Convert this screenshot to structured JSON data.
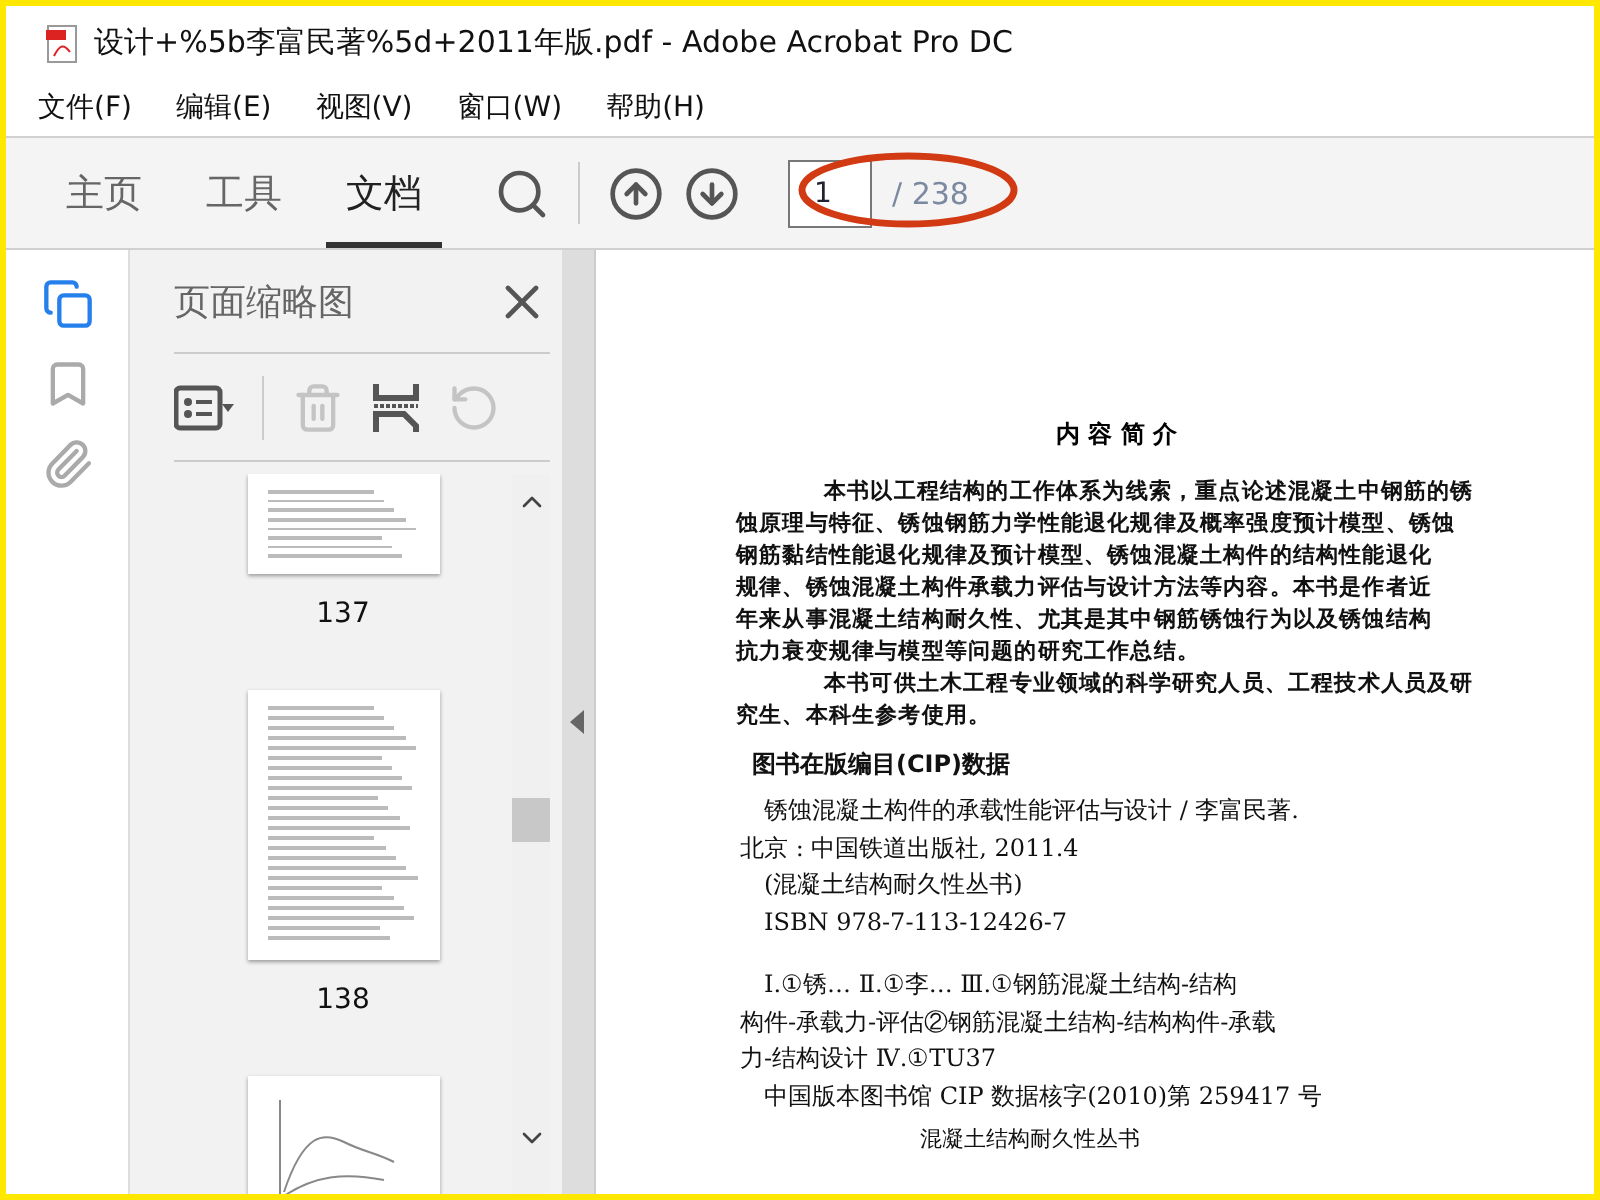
{
  "window": {
    "title": "设计+%5b李富民著%5d+2011年版.pdf - Adobe Acrobat Pro DC"
  },
  "menu": [
    {
      "label": "文件(F)"
    },
    {
      "label": "编辑(E)"
    },
    {
      "label": "视图(V)"
    },
    {
      "label": "窗口(W)"
    },
    {
      "label": "帮助(H)"
    }
  ],
  "tabs": [
    {
      "label": "主页",
      "selected": false
    },
    {
      "label": "工具",
      "selected": false
    },
    {
      "label": "文档",
      "selected": true
    }
  ],
  "page_nav": {
    "current": "1",
    "total": "/ 238"
  },
  "side_rail": [
    {
      "kind": "pages",
      "selected": true
    },
    {
      "kind": "bookmarks",
      "selected": false
    },
    {
      "kind": "attachments",
      "selected": false
    }
  ],
  "thumbnail_panel": {
    "title": "页面缩略图",
    "tools": [
      {
        "kind": "options",
        "disabled": false
      },
      {
        "kind": "delete",
        "disabled": true
      },
      {
        "kind": "insert",
        "disabled": false
      },
      {
        "kind": "rotate",
        "disabled": true
      }
    ],
    "thumbnails": [
      {
        "kind": "text",
        "label": "137"
      },
      {
        "kind": "text",
        "label": "138"
      },
      {
        "kind": "figure"
      }
    ]
  },
  "document": {
    "heading": "内 容 简 介",
    "summary": [
      [
        "本书以工程结构的工作体系为线索，重点论述混凝土中钢筋的锈",
        "蚀原理与特征、锈蚀钢筋力学性能退化规律及概率强度预计模型、锈蚀",
        "钢筋黏结性能退化规律及预计模型、锈蚀混凝土构件的结构性能退化",
        "规律、锈蚀混凝土构件承载力评估与设计方法等内容。本书是作者近",
        "年来从事混凝土结构耐久性、尤其是其中钢筋锈蚀行为以及锈蚀结构",
        "抗力衰变规律与模型等问题的研究工作总结。"
      ],
      [
        "本书可供土木工程专业领域的科学研究人员、工程技术人员及研",
        "究生、本科生参考使用。"
      ]
    ],
    "cip_heading": "图书在版编目(CIP)数据",
    "cip": [
      [
        "锈蚀混凝土构件的承载性能评估与设计 / 李富民著.",
        "北京 : 中国铁道出版社, 2011.4"
      ],
      [
        "(混凝土结构耐久性丛书)"
      ],
      [
        "ISBN 978-7-113-12426-7"
      ],
      [
        "Ⅰ.①锈… Ⅱ.①李… Ⅲ.①钢筋混凝土结构-结构",
        "构件-承载力-评估②钢筋混凝土结构-结构构件-承载",
        "力-结构设计 Ⅳ.①TU37"
      ],
      [
        "中国版本图书馆 CIP 数据核字(2010)第 259417 号"
      ]
    ],
    "series_footer": "混凝土结构耐久性丛书"
  }
}
